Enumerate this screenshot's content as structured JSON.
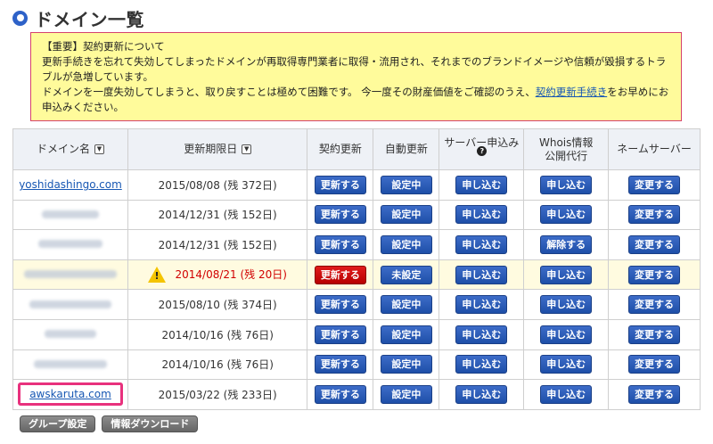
{
  "page": {
    "title": "ドメイン一覧"
  },
  "notice": {
    "heading": "【重要】契約更新について",
    "line1": "更新手続きを忘れて失効してしまったドメインが再取得専門業者に取得・流用され、それまでのブランドイメージや信頼が毀損するトラブルが急増しています。",
    "line2_before": "ドメインを一度失効してしまうと、取り戻すことは極めて困難です。 今一度その財産価値をご確認のうえ、",
    "line2_link": "契約更新手続き",
    "line2_after": "をお早めにお申込みください。"
  },
  "table": {
    "headers": {
      "domain": "ドメイン名",
      "expiry": "更新期限日",
      "renew": "契約更新",
      "auto_renew": "自動更新",
      "server": "サーバー申込み",
      "server_help": "?",
      "whois": "Whois情報\n公開代行",
      "nameserver": "ネームサーバー"
    },
    "sort_icon": "▼",
    "rows": [
      {
        "domain": "yoshidashingo.com",
        "expiry": "2015/08/08 (残 372日)",
        "renew": "更新する",
        "auto": "設定中",
        "server": "申し込む",
        "whois": "申し込む",
        "ns": "変更する"
      },
      {
        "domain": "",
        "expiry": "2014/12/31 (残 152日)",
        "renew": "更新する",
        "auto": "設定中",
        "server": "申し込む",
        "whois": "申し込む",
        "ns": "変更する"
      },
      {
        "domain": "",
        "expiry": "2014/12/31 (残 152日)",
        "renew": "更新する",
        "auto": "設定中",
        "server": "申し込む",
        "whois": "解除する",
        "ns": "変更する"
      },
      {
        "domain": "",
        "expiry": "2014/08/21 (残 20日)",
        "renew": "更新する",
        "auto": "未設定",
        "server": "申し込む",
        "whois": "申し込む",
        "ns": "変更する"
      },
      {
        "domain": "",
        "expiry": "2015/08/10 (残 374日)",
        "renew": "更新する",
        "auto": "設定中",
        "server": "申し込む",
        "whois": "申し込む",
        "ns": "変更する"
      },
      {
        "domain": "",
        "expiry": "2014/10/16 (残 76日)",
        "renew": "更新する",
        "auto": "設定中",
        "server": "申し込む",
        "whois": "申し込む",
        "ns": "変更する"
      },
      {
        "domain": "",
        "expiry": "2014/10/16 (残 76日)",
        "renew": "更新する",
        "auto": "設定中",
        "server": "申し込む",
        "whois": "申し込む",
        "ns": "変更する"
      },
      {
        "domain": "awskaruta.com",
        "expiry": "2015/03/22 (残 233日)",
        "renew": "更新する",
        "auto": "設定中",
        "server": "申し込む",
        "whois": "申し込む",
        "ns": "変更する"
      }
    ],
    "warning_symbol": "!"
  },
  "footer": {
    "group_settings": "グループ設定",
    "download": "情報ダウンロード"
  },
  "colors": {
    "accent_blue": "#2e62c8",
    "notice_bg": "#fffb9b",
    "notice_border": "#d6426e",
    "warning_red": "#d10000",
    "highlight_pink": "#e8317d"
  }
}
